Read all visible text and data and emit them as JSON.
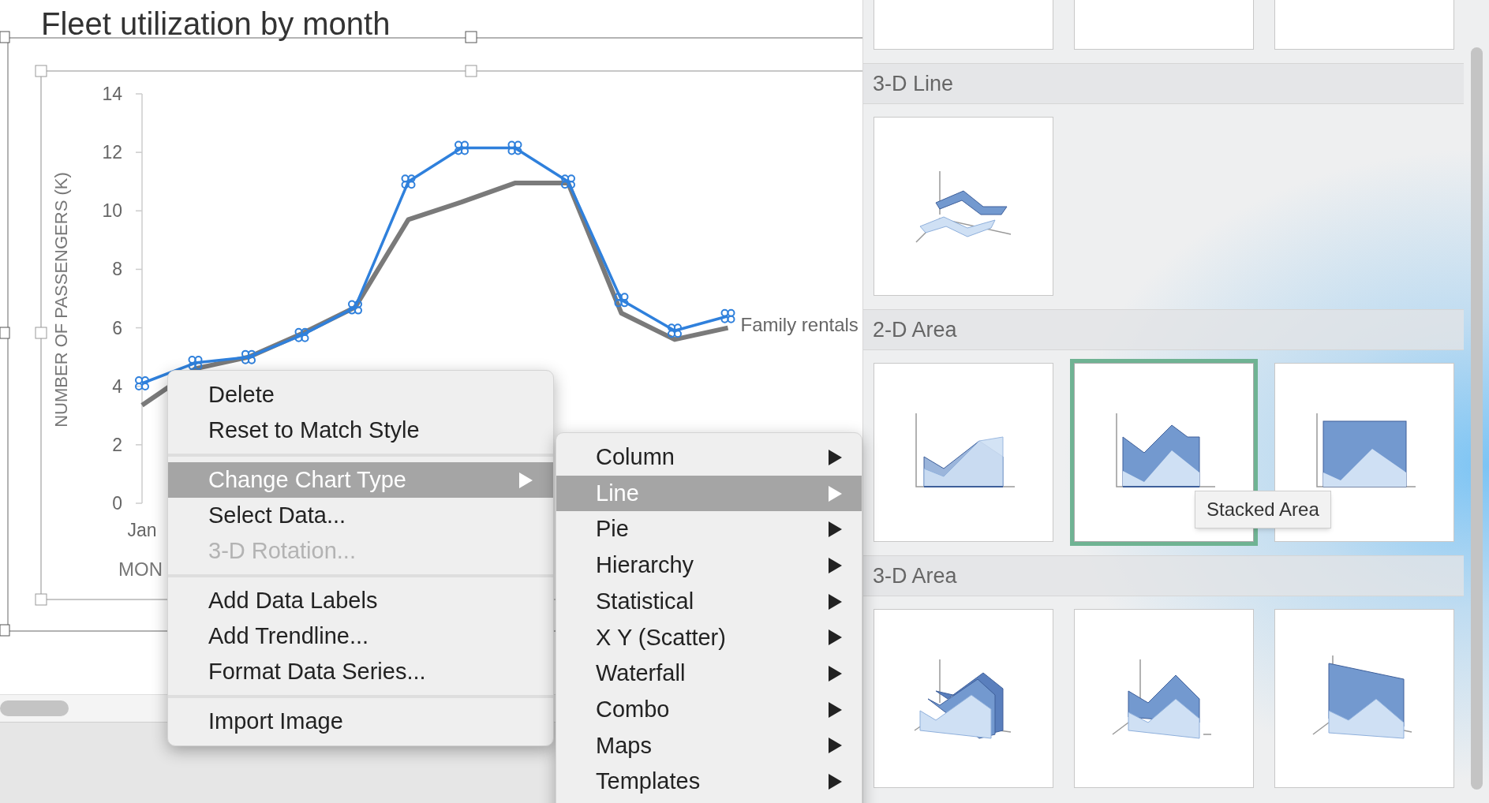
{
  "chart": {
    "title": "Fleet utilization by month",
    "first_month_label": "Jan",
    "chart_data": {
      "type": "line",
      "ylabel": "NUMBER OF PASSENGERS (K)",
      "xlabel": "MON",
      "ylim": [
        0,
        14
      ],
      "yticks": [
        {
          "value": 0,
          "label": "0"
        },
        {
          "value": 2,
          "label": "2"
        },
        {
          "value": 4,
          "label": "4"
        },
        {
          "value": 6,
          "label": "6"
        },
        {
          "value": 8,
          "label": "8"
        },
        {
          "value": 10,
          "label": "10"
        },
        {
          "value": 12,
          "label": "12"
        },
        {
          "value": 14,
          "label": "14"
        }
      ],
      "series": [
        {
          "color": "#2f80dc",
          "values": [
            4.1,
            4.8,
            5.0,
            5.75,
            6.7,
            11.0,
            12.15,
            12.15,
            11.0,
            6.95,
            5.9,
            6.4
          ]
        },
        {
          "name": "Family rentals",
          "color": "#7a7a7a",
          "values": [
            3.35,
            4.6,
            5.0,
            5.8,
            6.7,
            9.7,
            10.3,
            10.95,
            10.95,
            6.5,
            5.6,
            6.0
          ]
        }
      ]
    }
  },
  "context_menu": {
    "items": [
      {
        "kind": "item",
        "label": "Delete",
        "disabled": false,
        "selected": false,
        "submenu": false
      },
      {
        "kind": "item",
        "label": "Reset to Match Style",
        "disabled": false,
        "selected": false,
        "submenu": false
      },
      {
        "kind": "separator"
      },
      {
        "kind": "item",
        "label": "Change Chart Type",
        "disabled": false,
        "selected": true,
        "submenu": true
      },
      {
        "kind": "item",
        "label": "Select Data...",
        "disabled": false,
        "selected": false,
        "submenu": false
      },
      {
        "kind": "item",
        "label": "3-D Rotation...",
        "disabled": true,
        "selected": false,
        "submenu": false
      },
      {
        "kind": "separator"
      },
      {
        "kind": "item",
        "label": "Add Data Labels",
        "disabled": false,
        "selected": false,
        "submenu": false
      },
      {
        "kind": "item",
        "label": "Add Trendline...",
        "disabled": false,
        "selected": false,
        "submenu": false
      },
      {
        "kind": "item",
        "label": "Format Data Series...",
        "disabled": false,
        "selected": false,
        "submenu": false
      },
      {
        "kind": "separator"
      },
      {
        "kind": "item",
        "label": "Import Image",
        "disabled": false,
        "selected": false,
        "submenu": false
      }
    ]
  },
  "submenu": {
    "items": [
      {
        "label": "Column",
        "selected": false
      },
      {
        "label": "Line",
        "selected": true
      },
      {
        "label": "Pie",
        "selected": false
      },
      {
        "label": "Hierarchy",
        "selected": false
      },
      {
        "label": "Statistical",
        "selected": false
      },
      {
        "label": "X Y (Scatter)",
        "selected": false
      },
      {
        "label": "Waterfall",
        "selected": false
      },
      {
        "label": "Combo",
        "selected": false
      },
      {
        "label": "Maps",
        "selected": false
      },
      {
        "label": "Templates",
        "selected": false
      }
    ]
  },
  "gallery": {
    "top_row": [
      {
        "kind": "empty"
      },
      {
        "kind": "empty"
      },
      {
        "kind": "empty"
      }
    ],
    "sections": [
      {
        "title": "3-D Line",
        "tiles": [
          {
            "kind": "line3d",
            "selected": false
          }
        ]
      },
      {
        "title": "2-D Area",
        "tiles": [
          {
            "kind": "area",
            "selected": false
          },
          {
            "kind": "stacked_area",
            "selected": true
          },
          {
            "kind": "area100",
            "selected": false
          }
        ]
      },
      {
        "title": "3-D Area",
        "tiles": [
          {
            "kind": "area3d",
            "selected": false
          },
          {
            "kind": "stacked_area3d",
            "selected": false
          },
          {
            "kind": "area100_3d",
            "selected": false
          }
        ]
      }
    ],
    "tooltip": "Stacked Area"
  }
}
